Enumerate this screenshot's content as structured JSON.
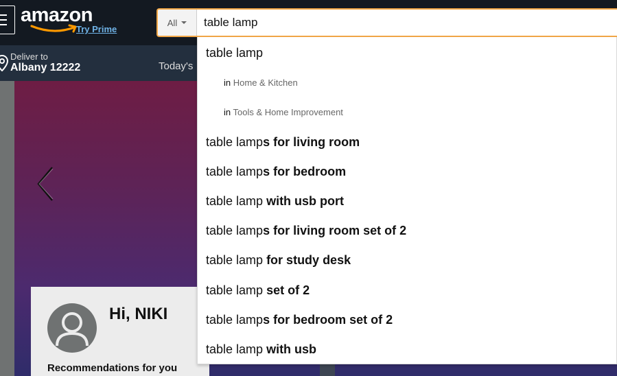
{
  "header": {
    "logo_text": "amazon",
    "try_prime": "Try Prime",
    "deliver_label": "Deliver to",
    "deliver_location": "Albany 12222",
    "todays_link": "Today's"
  },
  "search": {
    "category": "All",
    "query": "table lamp"
  },
  "suggestions": [
    {
      "prefix": "table lamp",
      "bold": ""
    },
    {
      "prefix": "table lamp",
      "bold": "s for living room"
    },
    {
      "prefix": "table lamp",
      "bold": "s for bedroom"
    },
    {
      "prefix": "table lamp",
      "bold": " with usb port"
    },
    {
      "prefix": "table lamp",
      "bold": "s for living room set of 2"
    },
    {
      "prefix": "table lamp",
      "bold": " for study desk"
    },
    {
      "prefix": "table lamp",
      "bold": " set of 2"
    },
    {
      "prefix": "table lamp",
      "bold": "s for bedroom set of 2"
    },
    {
      "prefix": "table lamp",
      "bold": " with usb"
    }
  ],
  "department_suggestions": [
    {
      "in": "in",
      "dept": "Home & Kitchen"
    },
    {
      "in": "in",
      "dept": "Tools & Home Improvement"
    }
  ],
  "card": {
    "greeting": "Hi, NIKI",
    "recommendations": "Recommendations for you"
  },
  "colors": {
    "nav_bg": "#131921",
    "subnav_bg": "#232f3e",
    "search_focus": "#f3a847",
    "prime_link": "#6fb2e6",
    "smile": "#f90"
  },
  "icons": [
    "hamburger-menu-icon",
    "location-pin-icon",
    "dropdown-caret-icon",
    "chevron-left-icon",
    "user-avatar-icon"
  ]
}
